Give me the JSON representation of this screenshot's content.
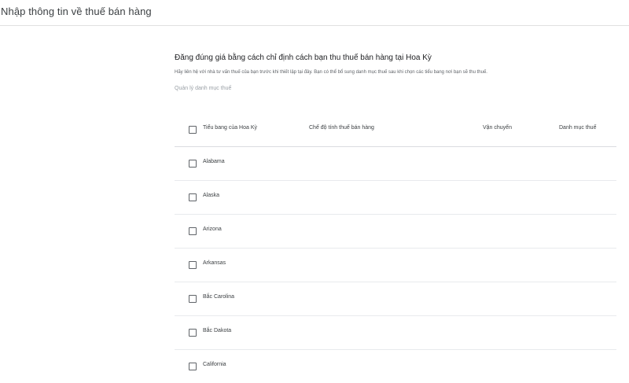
{
  "header": {
    "title": "Nhập thông tin về thuế bán hàng"
  },
  "section": {
    "title": "Đăng đúng giá bằng cách chỉ định cách bạn thu thuế bán hàng tại Hoa Kỳ",
    "description": "Hãy liên hệ với nhà tư vấn thuế của bạn trước khi thiết lập tại đây. Bạn có thể bổ sung danh mục thuế sau khi chọn các tiểu bang nơi bạn sẽ thu thuế.",
    "manage_link": "Quản lý danh mục thuế"
  },
  "table": {
    "columns": {
      "state": "Tiểu bang của Hoa Kỳ",
      "mode": "Chế độ tính thuế bán hàng",
      "shipping": "Vận chuyển",
      "category": "Danh mục thuế"
    },
    "rows": [
      {
        "state": "Alabama"
      },
      {
        "state": "Alaska"
      },
      {
        "state": "Arizona"
      },
      {
        "state": "Arkansas"
      },
      {
        "state": "Bắc Carolina"
      },
      {
        "state": "Bắc Dakota"
      },
      {
        "state": "California"
      }
    ]
  }
}
